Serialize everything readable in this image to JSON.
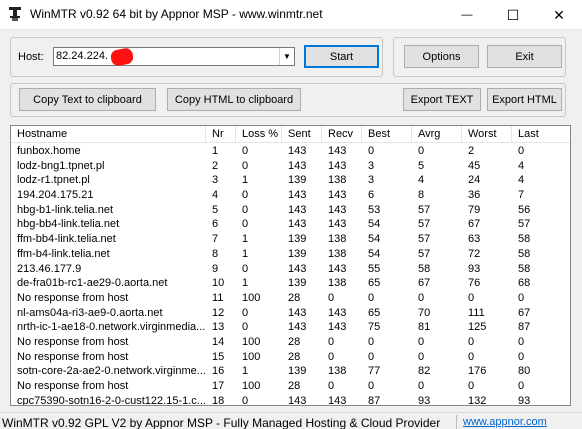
{
  "window": {
    "title": "WinMTR v0.92 64 bit by Appnor MSP - www.winmtr.net",
    "minimize_glyph": "—",
    "maximize_glyph": "☐",
    "close_glyph": "✕"
  },
  "host": {
    "label": "Host:",
    "value": "82.24.224."
  },
  "buttons": {
    "start": "Start",
    "options": "Options",
    "exit": "Exit",
    "copy_text": "Copy Text to clipboard",
    "copy_html": "Copy HTML to clipboard",
    "export_text": "Export TEXT",
    "export_html": "Export HTML"
  },
  "table": {
    "columns": [
      "Hostname",
      "Nr",
      "Loss %",
      "Sent",
      "Recv",
      "Best",
      "Avrg",
      "Worst",
      "Last"
    ],
    "rows": [
      [
        "funbox.home",
        "1",
        "0",
        "143",
        "143",
        "0",
        "0",
        "2",
        "0"
      ],
      [
        "lodz-bng1.tpnet.pl",
        "2",
        "0",
        "143",
        "143",
        "3",
        "5",
        "45",
        "4"
      ],
      [
        "lodz-r1.tpnet.pl",
        "3",
        "1",
        "139",
        "138",
        "3",
        "4",
        "24",
        "4"
      ],
      [
        "194.204.175.21",
        "4",
        "0",
        "143",
        "143",
        "6",
        "8",
        "36",
        "7"
      ],
      [
        "hbg-b1-link.telia.net",
        "5",
        "0",
        "143",
        "143",
        "53",
        "57",
        "79",
        "56"
      ],
      [
        "hbg-bb4-link.telia.net",
        "6",
        "0",
        "143",
        "143",
        "54",
        "57",
        "67",
        "57"
      ],
      [
        "ffm-bb4-link.telia.net",
        "7",
        "1",
        "139",
        "138",
        "54",
        "57",
        "63",
        "58"
      ],
      [
        "ffm-b4-link.telia.net",
        "8",
        "1",
        "139",
        "138",
        "54",
        "57",
        "72",
        "58"
      ],
      [
        "213.46.177.9",
        "9",
        "0",
        "143",
        "143",
        "55",
        "58",
        "93",
        "58"
      ],
      [
        "de-fra01b-rc1-ae29-0.aorta.net",
        "10",
        "1",
        "139",
        "138",
        "65",
        "67",
        "76",
        "68"
      ],
      [
        "No response from host",
        "11",
        "100",
        "28",
        "0",
        "0",
        "0",
        "0",
        "0"
      ],
      [
        "nl-ams04a-ri3-ae9-0.aorta.net",
        "12",
        "0",
        "143",
        "143",
        "65",
        "70",
        "111",
        "67"
      ],
      [
        "nrth-ic-1-ae18-0.network.virginmedia....",
        "13",
        "0",
        "143",
        "143",
        "75",
        "81",
        "125",
        "87"
      ],
      [
        "No response from host",
        "14",
        "100",
        "28",
        "0",
        "0",
        "0",
        "0",
        "0"
      ],
      [
        "No response from host",
        "15",
        "100",
        "28",
        "0",
        "0",
        "0",
        "0",
        "0"
      ],
      [
        "sotn-core-2a-ae2-0.network.virginme....",
        "16",
        "1",
        "139",
        "138",
        "77",
        "82",
        "176",
        "80"
      ],
      [
        "No response from host",
        "17",
        "100",
        "28",
        "0",
        "0",
        "0",
        "0",
        "0"
      ],
      [
        "cpc75390-sotn16-2-0-cust122.15-1.c...",
        "18",
        "0",
        "143",
        "143",
        "87",
        "93",
        "132",
        "93"
      ]
    ]
  },
  "status": {
    "text": "WinMTR v0.92 GPL V2 by Appnor MSP - Fully Managed Hosting & Cloud Provider",
    "link": "www.appnor.com"
  },
  "colors": {
    "accent": "#0078d7",
    "link": "#0066cc",
    "redaction": "#ff1010"
  }
}
